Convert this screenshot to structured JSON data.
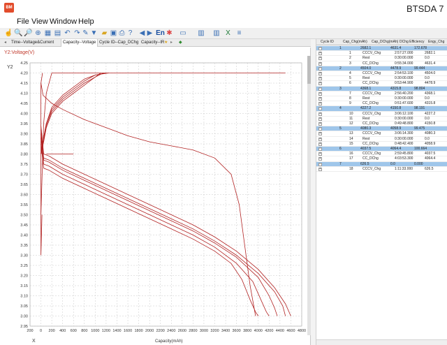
{
  "window": {
    "app_icon_text": "BM",
    "title": "BTSDA 7"
  },
  "menu": [
    "File",
    "View",
    "Window",
    "Help"
  ],
  "toolbar": {
    "en_label": "En"
  },
  "tabs": [
    "Time--Voltage&Current",
    "Capacity--Voltage",
    "Cycle ID--Cap_DChg",
    "Capacity--IR"
  ],
  "active_tab_index": 1,
  "chart": {
    "series_label": "Y2:Voltage(V)",
    "y_axis_name": "Y2",
    "x_axis_name": "X",
    "xlabel": "Capacity(mAh)",
    "color": "#b22222"
  },
  "chart_data": {
    "type": "line",
    "xlabel": "Capacity(mAh)",
    "ylabel": "Y2:Voltage(V)",
    "xlim": [
      -200,
      4800
    ],
    "ylim": [
      2.95,
      4.25
    ],
    "x_ticks": [
      -200,
      0,
      200,
      400,
      600,
      800,
      1000,
      1200,
      1400,
      1600,
      1800,
      2000,
      2200,
      2400,
      2600,
      2800,
      3000,
      3200,
      3400,
      3600,
      3800,
      4000,
      4200,
      4400,
      4600,
      4800
    ],
    "x_tick_labels": [
      "200",
      "0",
      "200",
      "400",
      "600",
      "800",
      "1000",
      "1200",
      "1400",
      "1600",
      "1800",
      "2000",
      "2200",
      "2400",
      "2600",
      "2800",
      "3000",
      "3200",
      "3400",
      "3600",
      "3800",
      "4000",
      "4200",
      "4400",
      "4600",
      "4800"
    ],
    "y_ticks": [
      "2.95",
      "3.00",
      "3.05",
      "3.10",
      "3.15",
      "3.20",
      "3.25",
      "3.30",
      "3.35",
      "3.40",
      "3.45",
      "3.50",
      "3.55",
      "3.60",
      "3.65",
      "3.70",
      "3.75",
      "3.80",
      "3.85",
      "3.90",
      "3.95",
      "4.00",
      "4.05",
      "4.10",
      "4.15",
      "4.20",
      "4.25"
    ],
    "grid": true,
    "series": [
      {
        "x": [
          0,
          50,
          150,
          400,
          800,
          1200,
          1600,
          2000,
          2400,
          2800,
          3200,
          3500,
          3700,
          3850,
          3950,
          4000
        ],
        "y": [
          3.85,
          3.73,
          3.72,
          3.68,
          3.63,
          3.58,
          3.53,
          3.48,
          3.43,
          3.38,
          3.32,
          3.26,
          3.18,
          3.08,
          3.02,
          3.0
        ]
      },
      {
        "x": [
          0,
          50,
          150,
          400,
          800,
          1200,
          1600,
          2000,
          2400,
          2800,
          3200,
          3600,
          3900,
          4050,
          4150,
          4200
        ],
        "y": [
          3.88,
          3.75,
          3.74,
          3.7,
          3.65,
          3.6,
          3.55,
          3.5,
          3.45,
          3.4,
          3.34,
          3.26,
          3.17,
          3.08,
          3.02,
          3.0
        ]
      },
      {
        "x": [
          0,
          50,
          150,
          400,
          800,
          1200,
          1600,
          2000,
          2400,
          2800,
          3200,
          3600,
          4000,
          4200,
          4300,
          4350
        ],
        "y": [
          3.9,
          3.77,
          3.76,
          3.72,
          3.67,
          3.62,
          3.57,
          3.52,
          3.47,
          3.42,
          3.36,
          3.29,
          3.19,
          3.1,
          3.04,
          3.0
        ]
      },
      {
        "x": [
          0,
          50,
          150,
          400,
          800,
          1200,
          1600,
          2000,
          2400,
          2800,
          3200,
          3600,
          4000,
          4300,
          4450,
          4500
        ],
        "y": [
          3.92,
          3.78,
          3.77,
          3.73,
          3.68,
          3.63,
          3.58,
          3.53,
          3.48,
          3.43,
          3.37,
          3.3,
          3.21,
          3.12,
          3.05,
          3.0
        ]
      },
      {
        "x": [
          0,
          50,
          150,
          400,
          800,
          1200,
          1600,
          2000,
          2400,
          2800,
          3200,
          3600,
          4000,
          4300,
          4500,
          4600
        ],
        "y": [
          3.94,
          3.8,
          3.79,
          3.75,
          3.7,
          3.65,
          3.6,
          3.55,
          3.5,
          3.45,
          3.39,
          3.32,
          3.23,
          3.14,
          3.06,
          3.0
        ]
      },
      {
        "x": [
          0,
          50,
          100,
          200,
          400,
          600,
          800,
          1000,
          1200
        ],
        "y": [
          3.8,
          3.88,
          3.95,
          4.02,
          4.08,
          4.12,
          4.16,
          4.19,
          4.2
        ]
      },
      {
        "x": [
          0,
          50,
          100,
          200,
          400,
          600,
          800,
          1000,
          1150
        ],
        "y": [
          3.8,
          3.87,
          3.94,
          4.01,
          4.07,
          4.11,
          4.15,
          4.18,
          4.2
        ]
      },
      {
        "x": [
          0,
          50,
          100,
          200,
          400,
          600,
          800,
          1000,
          1100
        ],
        "y": [
          3.8,
          3.86,
          3.93,
          4.0,
          4.06,
          4.1,
          4.14,
          4.18,
          4.2
        ]
      },
      {
        "x": [
          0,
          50,
          100,
          200,
          400,
          600,
          800,
          1000,
          1250
        ],
        "y": [
          3.8,
          3.88,
          3.95,
          4.03,
          4.09,
          4.13,
          4.17,
          4.19,
          4.2
        ]
      },
      {
        "x": [
          0,
          50,
          100,
          200,
          4500
        ],
        "y": [
          3.5,
          3.95,
          4.1,
          4.2,
          4.2
        ]
      },
      {
        "x": [
          0,
          40,
          200,
          400,
          800,
          1200,
          1600,
          2000,
          2400,
          2800,
          3200,
          3500,
          3650,
          3750,
          3850,
          3950
        ],
        "y": [
          4.15,
          4.09,
          4.05,
          4.02,
          3.97,
          3.93,
          3.89,
          3.86,
          3.84,
          3.82,
          3.78,
          3.7,
          3.55,
          3.35,
          3.15,
          3.0
        ]
      },
      {
        "x": [
          30,
          0,
          0,
          20
        ],
        "y": [
          4.2,
          4.15,
          3.3,
          3.5
        ]
      },
      {
        "x": [
          100,
          600
        ],
        "y": [
          3.8,
          3.8
        ]
      }
    ]
  },
  "grid": {
    "headers": [
      "Cycle ID",
      "Cap_Chg(mAh)",
      "Cap_DChg(mAh)",
      "DChg Efficiency",
      "Engy_Chg"
    ],
    "rows": [
      {
        "type": "cycle",
        "id": "1",
        "cap_chg": "2682.1",
        "cap_dchg": "4631.4",
        "eff": "172.678"
      },
      {
        "type": "step",
        "id": "1",
        "name": "CCCV_Chg",
        "time": "2:57:27.000",
        "cap": "2682.1"
      },
      {
        "type": "step",
        "id": "2",
        "name": "Rest",
        "time": "0:30:00.000",
        "cap": "0.0"
      },
      {
        "type": "step",
        "id": "3",
        "name": "CC_DChg",
        "time": "0:55:34.000",
        "cap": "4631.4"
      },
      {
        "type": "cycle",
        "id": "2",
        "cap_chg": "4504.0",
        "cap_dchg": "4478.9",
        "eff": "99.444"
      },
      {
        "type": "step",
        "id": "4",
        "name": "CCCV_Chg",
        "time": "2:54:53.100",
        "cap": "4504.0"
      },
      {
        "type": "step",
        "id": "5",
        "name": "Rest",
        "time": "0:30:00.000",
        "cap": "0.0"
      },
      {
        "type": "step",
        "id": "6",
        "name": "CC_DChg",
        "time": "0:53:44.900",
        "cap": "4478.9"
      },
      {
        "type": "cycle",
        "id": "3",
        "cap_chg": "4368.1",
        "cap_dchg": "4315.8",
        "eff": "98.804"
      },
      {
        "type": "step",
        "id": "7",
        "name": "CCCV_Chg",
        "time": "2:56:40.200",
        "cap": "4368.1"
      },
      {
        "type": "step",
        "id": "8",
        "name": "Rest",
        "time": "0:30:00.000",
        "cap": "0.0"
      },
      {
        "type": "step",
        "id": "9",
        "name": "CC_DChg",
        "time": "0:51:47.600",
        "cap": "4315.8"
      },
      {
        "type": "cycle",
        "id": "4",
        "cap_chg": "4227.2",
        "cap_dchg": "4150.8",
        "eff": "98.191"
      },
      {
        "type": "step",
        "id": "10",
        "name": "CCCV_Chg",
        "time": "3:06:12.100",
        "cap": "4227.2"
      },
      {
        "type": "step",
        "id": "11",
        "name": "Rest",
        "time": "0:30:00.000",
        "cap": "0.0"
      },
      {
        "type": "step",
        "id": "12",
        "name": "CC_DChg",
        "time": "0:49:48.800",
        "cap": "4150.8"
      },
      {
        "type": "cycle",
        "id": "5",
        "cap_chg": "4080.3",
        "cap_dchg": "4058.9",
        "eff": "99.475"
      },
      {
        "type": "step",
        "id": "13",
        "name": "CCCV_Chg",
        "time": "3:06:14.300",
        "cap": "4080.3"
      },
      {
        "type": "step",
        "id": "14",
        "name": "Rest",
        "time": "0:30:00.000",
        "cap": "0.0"
      },
      {
        "type": "step",
        "id": "15",
        "name": "CC_DChg",
        "time": "0:48:42.400",
        "cap": "4058.9"
      },
      {
        "type": "cycle",
        "id": "6",
        "cap_chg": "4037.5",
        "cap_dchg": "4064.4",
        "eff": "100.664"
      },
      {
        "type": "step",
        "id": "16",
        "name": "CCCV_Chg",
        "time": "2:59:45.800",
        "cap": "4037.5"
      },
      {
        "type": "step",
        "id": "17",
        "name": "CC_DChg",
        "time": "4:03:53.300",
        "cap": "4064.4"
      },
      {
        "type": "cycle",
        "id": "7",
        "cap_chg": "626.5",
        "cap_dchg": "0.0",
        "eff": "0.000"
      },
      {
        "type": "step",
        "id": "18",
        "name": "CCCV_Chg",
        "time": "1:11:33.000",
        "cap": "626.5"
      }
    ]
  }
}
